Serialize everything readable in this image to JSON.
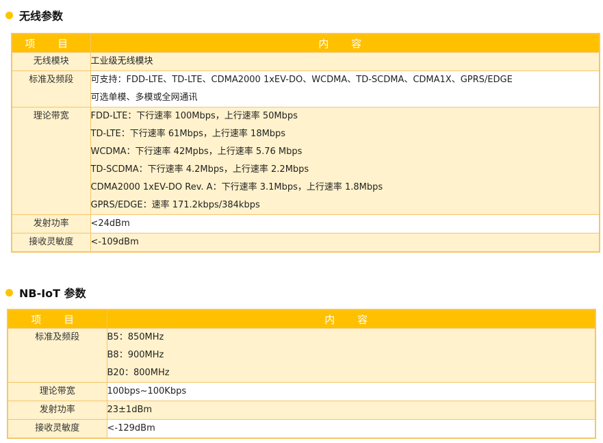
{
  "wireless": {
    "title": "无线参数",
    "header": {
      "col1": "项 目",
      "col2": "内 容"
    },
    "rows": [
      {
        "key": "无线模块",
        "lines": [
          "工业级无线模块"
        ]
      },
      {
        "key": "标准及频段",
        "lines": [
          "可支持：FDD-LTE、TD-LTE、CDMA2000 1xEV-DO、WCDMA、TD-SCDMA、CDMA1X、GPRS/EDGE",
          "可选单模、多模或全网通讯"
        ]
      },
      {
        "key": "理论带宽",
        "lines": [
          "FDD-LTE：下行速率 100Mbps，上行速率 50Mbps",
          "TD-LTE：下行速率 61Mbps，上行速率 18Mbps",
          "WCDMA：下行速率 42Mpbs，上行速率 5.76 Mbps",
          "TD-SCDMA：下行速率 4.2Mbps，上行速率 2.2Mbps",
          "CDMA2000 1xEV-DO Rev. A：下行速率 3.1Mbps，上行速率 1.8Mbps",
          "GPRS/EDGE：速率 171.2kbps/384kbps"
        ]
      },
      {
        "key": "发射功率",
        "lines": [
          "<24dBm"
        ]
      },
      {
        "key": "接收灵敏度",
        "lines": [
          "<-109dBm"
        ]
      }
    ]
  },
  "nbiot": {
    "title": "NB-IoT 参数",
    "header": {
      "col1": "项 目",
      "col2": "内 容"
    },
    "rows": [
      {
        "key": "标准及频段",
        "lines": [
          "B5：850MHz",
          "B8：900MHz",
          "B20：800MHz"
        ]
      },
      {
        "key": "理论带宽",
        "lines": [
          "100bps~100Kbps"
        ]
      },
      {
        "key": "发射功率",
        "lines": [
          "23±1dBm"
        ]
      },
      {
        "key": "接收灵敏度",
        "lines": [
          "<-129dBm"
        ]
      }
    ]
  },
  "colors": {
    "accent": "#FFC000",
    "row_fill": "#FFF2CC",
    "border": "#F5C56A"
  }
}
